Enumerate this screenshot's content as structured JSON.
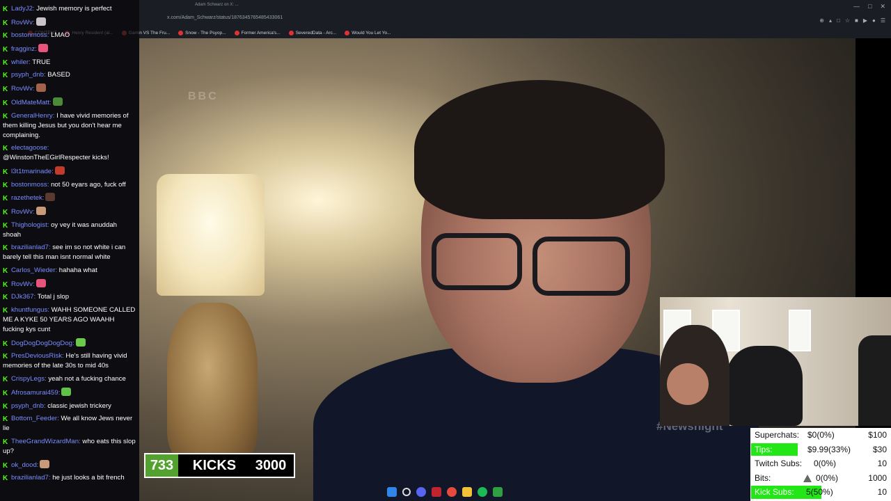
{
  "browser": {
    "tab_title": "Adam Schwarz on X: ...",
    "url": "x.com/Adam_Schwarz/status/1876345765485433061",
    "bookmarks": [
      {
        "label": "CONTENT"
      },
      {
        "label": "Henry Resident (al..."
      },
      {
        "label": "Gamin VS The Fru..."
      },
      {
        "label": "Snow - The Psyop..."
      },
      {
        "label": "Former America's..."
      },
      {
        "label": "SeveredData - Arc..."
      },
      {
        "label": "Would You Let Yo..."
      }
    ]
  },
  "video": {
    "watermark": "#Newsnight",
    "corner_logo": "BBC"
  },
  "chat": {
    "messages": [
      {
        "user": "LadyJ2:",
        "text": "Jewish memory is perfect",
        "emote": ""
      },
      {
        "user": "RovWv:",
        "text": "",
        "emote": "#c9c2c9"
      },
      {
        "user": "bostonmoss:",
        "text": "LMAO",
        "emote": ""
      },
      {
        "user": "fragginz:",
        "text": "",
        "emote": "#e8547c"
      },
      {
        "user": "whiler:",
        "text": "TRUE",
        "emote": ""
      },
      {
        "user": "psyph_dnb:",
        "text": "BASED",
        "emote": ""
      },
      {
        "user": "RovWv:",
        "text": "",
        "emote": "#a3624c"
      },
      {
        "user": "OldMateMatt:",
        "text": "",
        "emote": "#4c8a3a"
      },
      {
        "user": "GeneralHenry:",
        "text": "I have vivid memories of them killing Jesus but you don't hear me complaining.",
        "emote": ""
      },
      {
        "user": "electagoose:",
        "text": "@WinstonTheEGirlRespecter kicks!",
        "emote": ""
      },
      {
        "user": "l3t1tmarinade:",
        "text": "",
        "emote": "#c23a2b"
      },
      {
        "user": "bostonmoss:",
        "text": "not 50 eyars ago, fuck off",
        "emote": ""
      },
      {
        "user": "razethetek:",
        "text": "",
        "emote": "#5a3a30"
      },
      {
        "user": "RovWv:",
        "text": "",
        "emote": "#c99a7a"
      },
      {
        "user": "Thighologist:",
        "text": "oy vey it was anuddah shoah",
        "emote": ""
      },
      {
        "user": "brazilianlad7:",
        "text": "see im so not white i can barely tell this man isnt normal white",
        "emote": ""
      },
      {
        "user": "Carlos_Wieder:",
        "text": "hahaha what",
        "emote": ""
      },
      {
        "user": "RovWv:",
        "text": "",
        "emote": "#e8547c"
      },
      {
        "user": "DJk367:",
        "text": "Total j slop",
        "emote": ""
      },
      {
        "user": "khuntfungus:",
        "text": "WAHH SOMEONE CALLED ME A KYKE 50 YEARS AGO WAAHH fucking kys cunt",
        "emote": ""
      },
      {
        "user": "DogDogDogDogDog:",
        "text": "",
        "emote": "#6acb4a"
      },
      {
        "user": "PresDeviousRisk:",
        "text": "He's still having vivid memories of the late 30s to mid 40s",
        "emote": ""
      },
      {
        "user": "CrispyLegs:",
        "text": "yeah not a fucking chance",
        "emote": ""
      },
      {
        "user": "Afrosamurai459:",
        "text": "",
        "emote": "#5fc34a"
      },
      {
        "user": "psyph_dnb:",
        "text": "classic jewish trickery",
        "emote": ""
      },
      {
        "user": "Bottom_Feeder:",
        "text": "We all know Jews never lie",
        "emote": ""
      },
      {
        "user": "TheeGrandWizardMan:",
        "text": "who eats this slop up?",
        "emote": ""
      },
      {
        "user": "ok_dood:",
        "text": "",
        "emote": "#c99a7a"
      },
      {
        "user": "brazilianlad7:",
        "text": "he just looks a bit french",
        "emote": ""
      }
    ]
  },
  "kicks_goal": {
    "current": "733",
    "label": "KICKS",
    "target": "3000",
    "progress": 0.244
  },
  "stats": {
    "rows": [
      {
        "label": "Superchats:",
        "value": "$0(0%)",
        "target": "$100",
        "progress": 0.0
      },
      {
        "label": "Tips:",
        "value": "$9.99(33%)",
        "target": "$30",
        "progress": 0.33
      },
      {
        "label": "Twitch Subs:",
        "value": "0(0%)",
        "target": "10",
        "progress": 0.0
      },
      {
        "label": "Bits:",
        "value": "0(0%)",
        "target": "1000",
        "progress": 0.0
      },
      {
        "label": "Kick Subs:",
        "value": "5(50%)",
        "target": "10",
        "progress": 0.5
      }
    ]
  },
  "colors": {
    "kick_green": "#53fc18",
    "username_blue": "#7b8cff",
    "progress_green": "#22e616",
    "kicks_bar_green": "#53a22f"
  }
}
